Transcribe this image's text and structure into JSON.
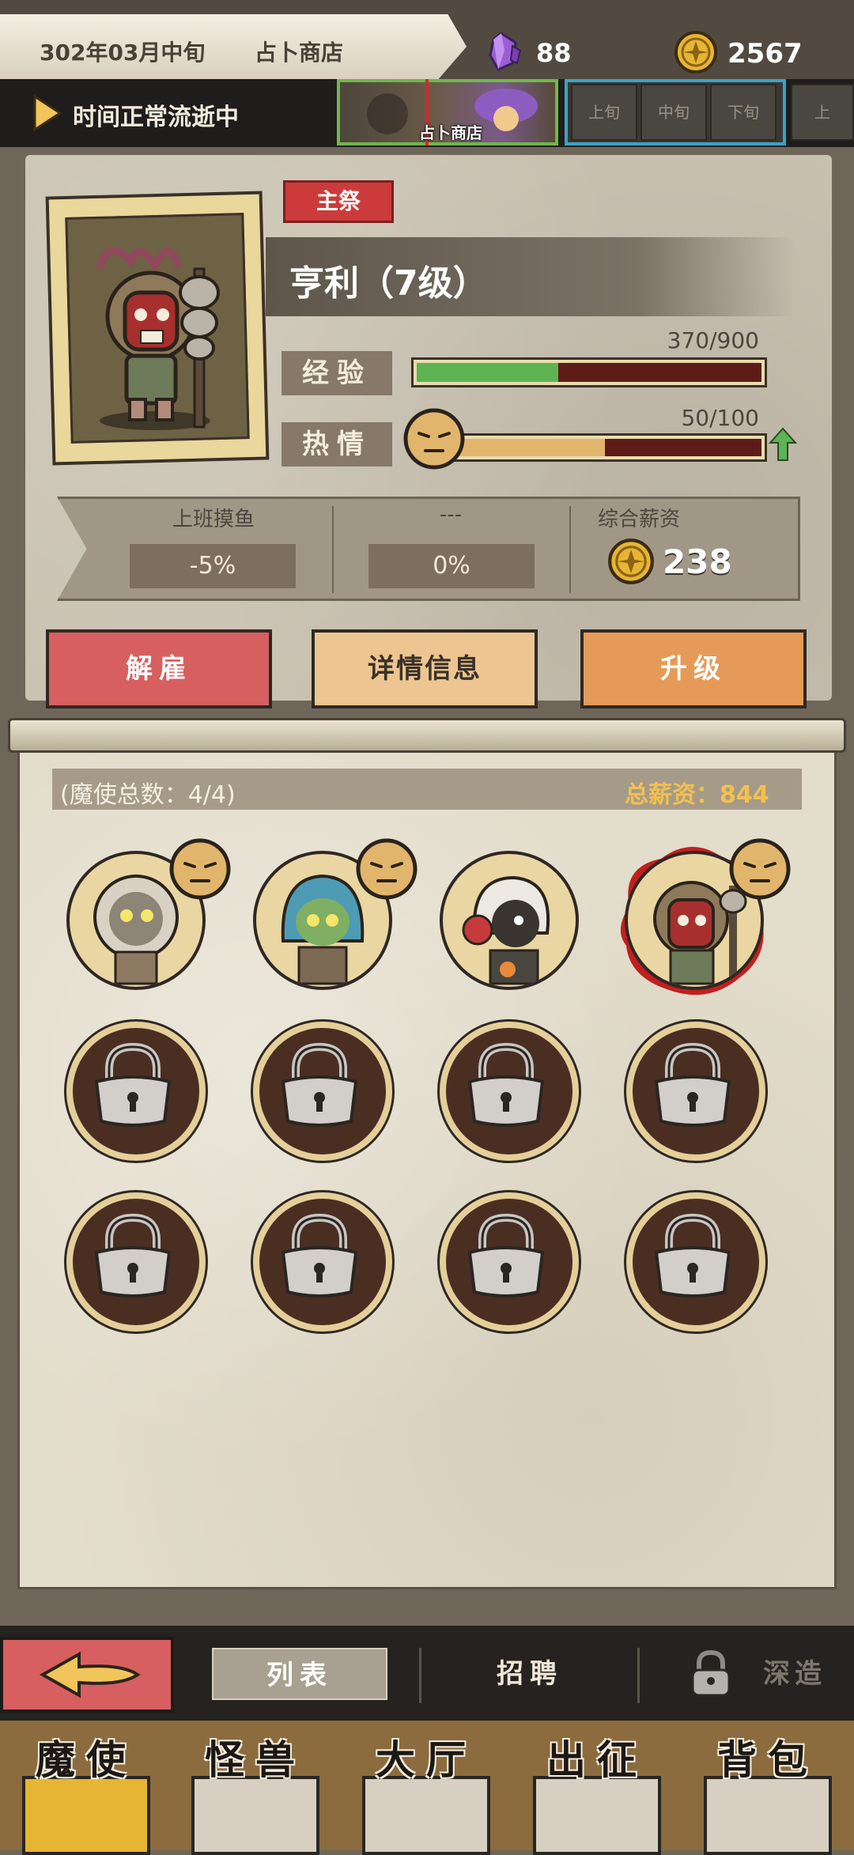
{
  "header": {
    "date": "302年03月中旬",
    "location": "占卜商店",
    "crystals": "88",
    "coins": "2567",
    "status": "时间正常流逝中",
    "timeline_current": "占卜商店",
    "timeline_slots": [
      "上旬",
      "中旬",
      "下旬",
      "上"
    ]
  },
  "character": {
    "role": "主祭",
    "name": "亨利（7级）",
    "exp_label": "经验",
    "exp_value": "370/900",
    "exp_fraction": 0.411,
    "mood_label": "热情",
    "mood_value": "50/100",
    "mood_fraction": 0.5
  },
  "stats": {
    "slack_label": "上班摸鱼",
    "slack_value": "-5%",
    "blank_label": "---",
    "blank_value": "0%",
    "salary_label": "综合薪资",
    "salary_value": "238"
  },
  "actions": {
    "fire": "解雇",
    "details": "详情信息",
    "upgrade": "升级"
  },
  "roster": {
    "count_text": "(魔使总数：4/4)",
    "total_salary": "总薪资：844",
    "members": [
      {
        "name": "lion-mage"
      },
      {
        "name": "hooded-mage"
      },
      {
        "name": "white-hair-mage"
      },
      {
        "name": "henry",
        "selected": true
      }
    ],
    "locked_slots": 8
  },
  "subnav": {
    "list": "列表",
    "recruit": "招聘",
    "forge": "深造"
  },
  "mainnav": {
    "tabs": [
      "魔使",
      "怪兽",
      "大厅",
      "出征",
      "背包"
    ]
  },
  "colors": {
    "exp_green": "#5eb352",
    "bar_bg": "#5d1c17",
    "mood_tan": "#e2b56d",
    "accent_red": "#cc3b3b",
    "coin_gold": "#e6b533"
  }
}
